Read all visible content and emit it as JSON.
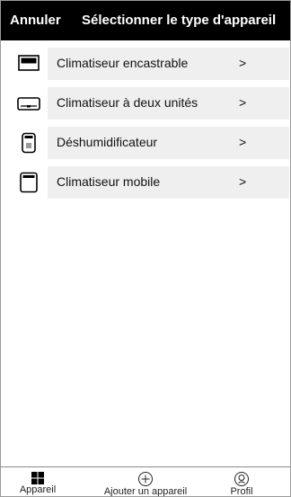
{
  "header": {
    "cancel_label": "Annuler",
    "title": "Sélectionner le type d'appareil"
  },
  "devices": [
    {
      "label": "Climatiseur encastrable",
      "chevron": ">",
      "icon": "built-in-ac-icon"
    },
    {
      "label": "Climatiseur à deux unités",
      "chevron": ">",
      "icon": "split-ac-icon"
    },
    {
      "label": "Déshumidificateur",
      "chevron": ">",
      "icon": "dehumidifier-icon"
    },
    {
      "label": "Climatiseur mobile",
      "chevron": ">",
      "icon": "portable-ac-icon"
    }
  ],
  "tabbar": {
    "tabs": [
      {
        "label": "Appareil",
        "icon": "grid-icon"
      },
      {
        "label": "Ajouter un appareil",
        "icon": "plus-circle-icon"
      },
      {
        "label": "Profil",
        "icon": "profile-icon"
      }
    ]
  },
  "colors": {
    "header_bg": "#000000",
    "header_text": "#ffffff",
    "row_bg": "#efefef"
  }
}
